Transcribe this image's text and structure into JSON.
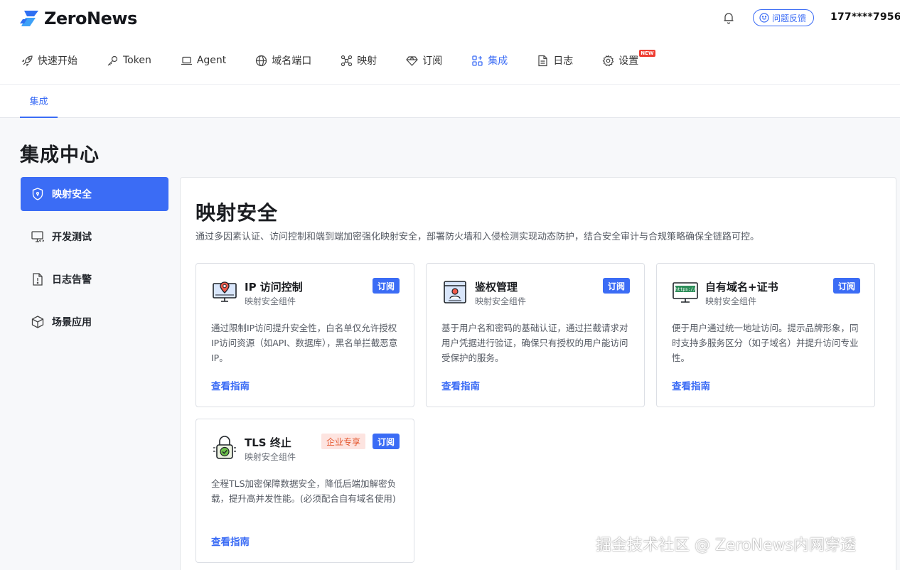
{
  "app": {
    "logo_text": "ZeroNews"
  },
  "header": {
    "feedback_label": "问题反馈",
    "user_phone": "177****7956"
  },
  "nav": {
    "items": [
      {
        "label": "快速开始",
        "icon": "rocket-icon"
      },
      {
        "label": "Token",
        "icon": "key-icon"
      },
      {
        "label": "Agent",
        "icon": "laptop-icon"
      },
      {
        "label": "域名端口",
        "icon": "globe-icon"
      },
      {
        "label": "映射",
        "icon": "network-icon"
      },
      {
        "label": "订阅",
        "icon": "diamond-icon"
      },
      {
        "label": "集成",
        "icon": "grid-icon",
        "active": true
      },
      {
        "label": "日志",
        "icon": "document-icon"
      },
      {
        "label": "设置",
        "icon": "gear-icon",
        "badge": "NEW"
      }
    ]
  },
  "subnav": {
    "active_tab": "集成"
  },
  "page": {
    "title": "集成中心"
  },
  "sidebar": {
    "items": [
      {
        "label": "映射安全",
        "icon": "shield-icon",
        "active": true
      },
      {
        "label": "开发测试",
        "icon": "monitor-code-icon"
      },
      {
        "label": "日志告警",
        "icon": "alert-file-icon"
      },
      {
        "label": "场景应用",
        "icon": "cube-icon"
      }
    ]
  },
  "panel": {
    "title": "映射安全",
    "description": "通过多因素认证、访问控制和端到端加密强化映射安全，部署防火墙和入侵检测实现动态防护，结合安全审计与合规策略确保全链路可控。",
    "cards": [
      {
        "name": "IP 访问控制",
        "sub": "映射安全组件",
        "tag": "订阅",
        "desc": "通过限制IP访问提升安全性，白名单仅允许授权IP访问资源（如API、数据库），黑名单拦截恶意IP。",
        "link": "查看指南",
        "icon": "ip-location-icon"
      },
      {
        "name": "鉴权管理",
        "sub": "映射安全组件",
        "tag": "订阅",
        "desc": "基于用户名和密码的基础认证，通过拦截请求对用户凭据进行验证，确保只有授权的用户能访问受保护的服务。",
        "link": "查看指南",
        "icon": "user-auth-icon"
      },
      {
        "name": "自有域名+证书",
        "sub": "映射安全组件",
        "tag": "订阅",
        "desc": "便于用户通过统一地址访问。提示品牌形象，同时支持多服务区分（如子域名）并提升访问专业性。",
        "link": "查看指南",
        "icon": "https-monitor-icon",
        "icon_text": "https://"
      },
      {
        "name": "TLS 终止",
        "sub": "映射安全组件",
        "tag": "订阅",
        "ent_tag": "企业专享",
        "desc": "全程TLS加密保障数据安全，降低后端加解密负载，提升高并发性能。(必须配合自有域名使用)",
        "link": "查看指南",
        "icon": "lock-check-icon"
      }
    ]
  },
  "watermark": "掘金技术社区 @ ZeroNews内网穿透",
  "colors": {
    "accent": "#3b6cf5",
    "enterprise_tag_bg": "#fde4e0",
    "enterprise_tag_text": "#e4572e",
    "new_badge": "#ee3d32"
  }
}
